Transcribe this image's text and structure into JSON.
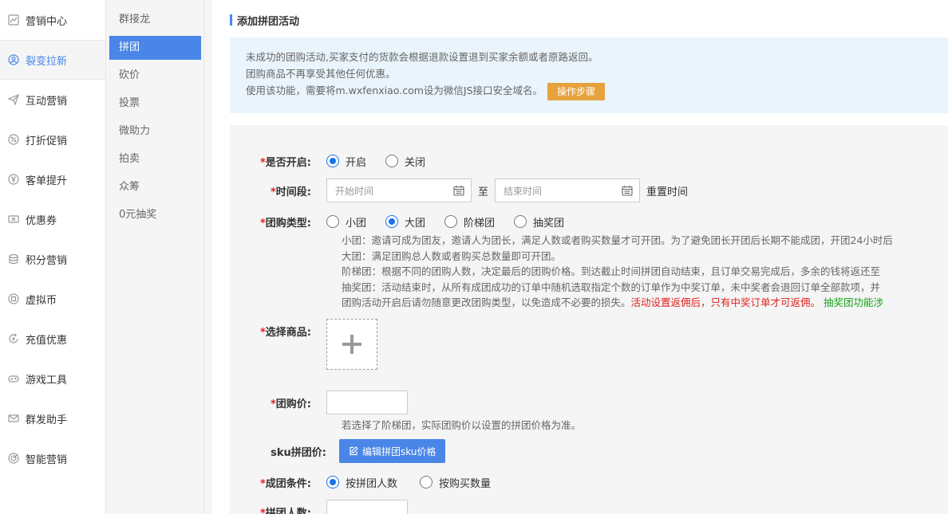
{
  "nav_main": [
    {
      "label": "营销中心",
      "icon": "chart-line-icon"
    },
    {
      "label": "裂变拉新",
      "icon": "user-circle-icon",
      "active": true
    },
    {
      "label": "互动营销",
      "icon": "paper-plane-icon"
    },
    {
      "label": "打折促销",
      "icon": "discount-icon"
    },
    {
      "label": "客单提升",
      "icon": "yen-circle-icon"
    },
    {
      "label": "优惠券",
      "icon": "coupon-icon"
    },
    {
      "label": "积分营销",
      "icon": "coins-icon"
    },
    {
      "label": "虚拟币",
      "icon": "coin-icon"
    },
    {
      "label": "充值优惠",
      "icon": "recharge-icon"
    },
    {
      "label": "游戏工具",
      "icon": "gamepad-icon"
    },
    {
      "label": "群发助手",
      "icon": "mail-icon"
    },
    {
      "label": "智能营销",
      "icon": "target-icon"
    }
  ],
  "nav_sub": [
    {
      "label": "群接龙"
    },
    {
      "label": "拼团",
      "active": true
    },
    {
      "label": "砍价"
    },
    {
      "label": "投票"
    },
    {
      "label": "微助力"
    },
    {
      "label": "拍卖"
    },
    {
      "label": "众筹"
    },
    {
      "label": "0元抽奖"
    }
  ],
  "header": {
    "title": "添加拼团活动"
  },
  "notice": {
    "line1": "未成功的团购活动,买家支付的货款会根据退款设置退到买家余额或者原路返回。",
    "line2": "团购商品不再享受其他任何优惠。",
    "line3": "使用该功能，需要将m.wxfenxiao.com设为微信JS接口安全域名。",
    "steps_button": "操作步骤"
  },
  "form": {
    "required_mark": "*",
    "enable": {
      "label": "是否开启:",
      "options": [
        "开启",
        "关闭"
      ],
      "selected": 0
    },
    "period": {
      "label": "时间段:",
      "start_placeholder": "开始时间",
      "to": "至",
      "end_placeholder": "结束时间",
      "reset": "重置时间"
    },
    "group_type": {
      "label": "团购类型:",
      "options": [
        "小团",
        "大团",
        "阶梯团",
        "抽奖团"
      ],
      "selected": 1,
      "desc": [
        "小团：邀请可成为团友，邀请人为团长，满足人数或者购买数量才可开团。为了避免团长开团后长期不能成团，开团24小时后",
        "大团：满足团购总人数或者购买总数量即可开团。",
        "阶梯团：根据不同的团购人数，决定最后的团购价格。到达截止时间拼团自动结束，且订单交易完成后，多余的钱将返还至",
        "抽奖团：活动结束时，从所有成团成功的订单中随机选取指定个数的订单作为中奖订单，未中奖者会退回订单全部款项，并",
        "团购活动开启后请勿随意更改团购类型，以免造成不必要的损失。"
      ],
      "desc_red": "活动设置返佣后，只有中奖订单才可返佣。",
      "desc_green": "抽奖团功能涉"
    },
    "product": {
      "label": "选择商品:"
    },
    "group_price": {
      "label": "团购价:",
      "hint": "若选择了阶梯团，实际团购价以设置的拼团价格为准。"
    },
    "sku_price": {
      "label": "sku拼团价:",
      "button": "编辑拼团sku价格"
    },
    "condition": {
      "label": "成团条件:",
      "options": [
        "按拼团人数",
        "按购买数量"
      ],
      "selected": 0
    },
    "group_size": {
      "label": "拼团人数:"
    }
  }
}
